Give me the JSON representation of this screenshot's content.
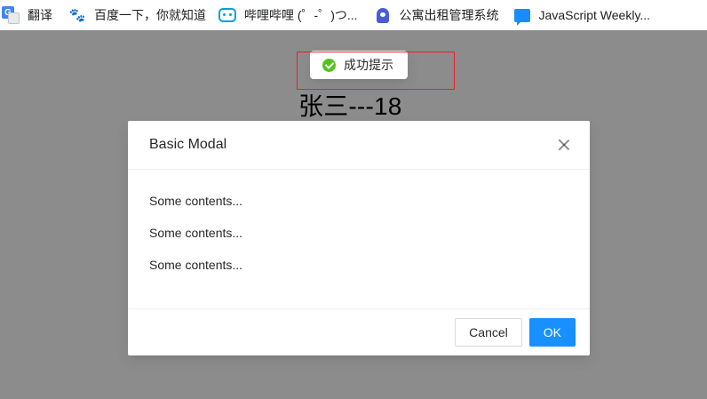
{
  "bookmarks": [
    {
      "label": "翻译",
      "icon": "google-translate-icon"
    },
    {
      "label": "百度一下，你就知道",
      "icon": "baidu-paw-icon"
    },
    {
      "label": "哔哩哔哩 (゜-゜)つ...",
      "icon": "bilibili-tv-icon"
    },
    {
      "label": "公寓出租管理系统",
      "icon": "rental-app-icon"
    },
    {
      "label": "JavaScript Weekly...",
      "icon": "chat-bubble-icon"
    }
  ],
  "page": {
    "heading": "张三---18"
  },
  "toast": {
    "message": "成功提示",
    "icon": "check-circle-icon",
    "color": "#52c41a"
  },
  "modal": {
    "title": "Basic Modal",
    "contents": [
      "Some contents...",
      "Some contents...",
      "Some contents..."
    ],
    "cancel_label": "Cancel",
    "ok_label": "OK",
    "ok_color": "#1890ff"
  },
  "annotation": {
    "highlight_color": "#e8202a"
  }
}
